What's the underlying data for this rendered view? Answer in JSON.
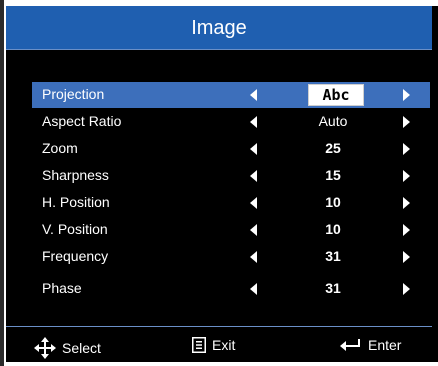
{
  "window": {
    "title": "Image"
  },
  "menu": {
    "rows": [
      {
        "label": "Projection",
        "value": "Abc",
        "value_style": "box",
        "selected": true
      },
      {
        "label": "Aspect Ratio",
        "value": "Auto",
        "value_style": "plain",
        "selected": false
      },
      {
        "label": "Zoom",
        "value": "25",
        "value_style": "bold",
        "selected": false
      },
      {
        "label": "Sharpness",
        "value": "15",
        "value_style": "bold",
        "selected": false
      },
      {
        "label": "H. Position",
        "value": "10",
        "value_style": "bold",
        "selected": false
      },
      {
        "label": "V. Position",
        "value": "10",
        "value_style": "bold",
        "selected": false
      },
      {
        "label": "Frequency",
        "value": "31",
        "value_style": "bold",
        "selected": false
      },
      {
        "label": "Phase",
        "value": "31",
        "value_style": "bold",
        "selected": false
      }
    ]
  },
  "footer": {
    "select_label": "Select",
    "select_icon": "four-way-arrows-icon",
    "exit_label": "Exit",
    "exit_icon": "menu-icon",
    "enter_label": "Enter",
    "enter_icon": "enter-arrow-icon"
  },
  "colors": {
    "title_bar": "#1f5fb0",
    "selected_row": "#3d6fbb",
    "background": "#000000",
    "text": "#ffffff"
  }
}
